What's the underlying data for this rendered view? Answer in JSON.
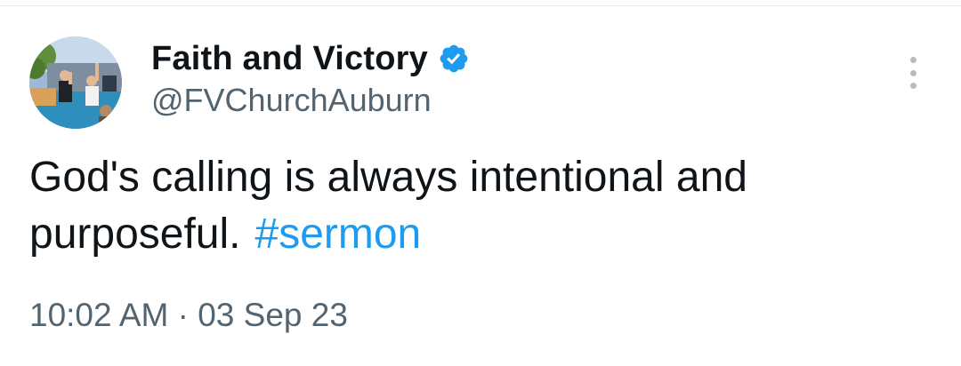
{
  "tweet": {
    "author": {
      "display_name": "Faith and Victory",
      "handle": "@FVChurchAuburn",
      "verified": true,
      "avatar_icon": "church-baptism-photo"
    },
    "text": "God's calling is always intentional and purposeful.",
    "hashtag": "#sermon",
    "timestamp": "10:02 AM · 03 Sep 23"
  },
  "colors": {
    "text": "#0f1419",
    "secondary": "#536471",
    "link": "#1d9bf0",
    "verified_badge": "#1d9bf0"
  },
  "icons": {
    "verified": "verified-badge-icon",
    "more": "more-options-icon"
  }
}
